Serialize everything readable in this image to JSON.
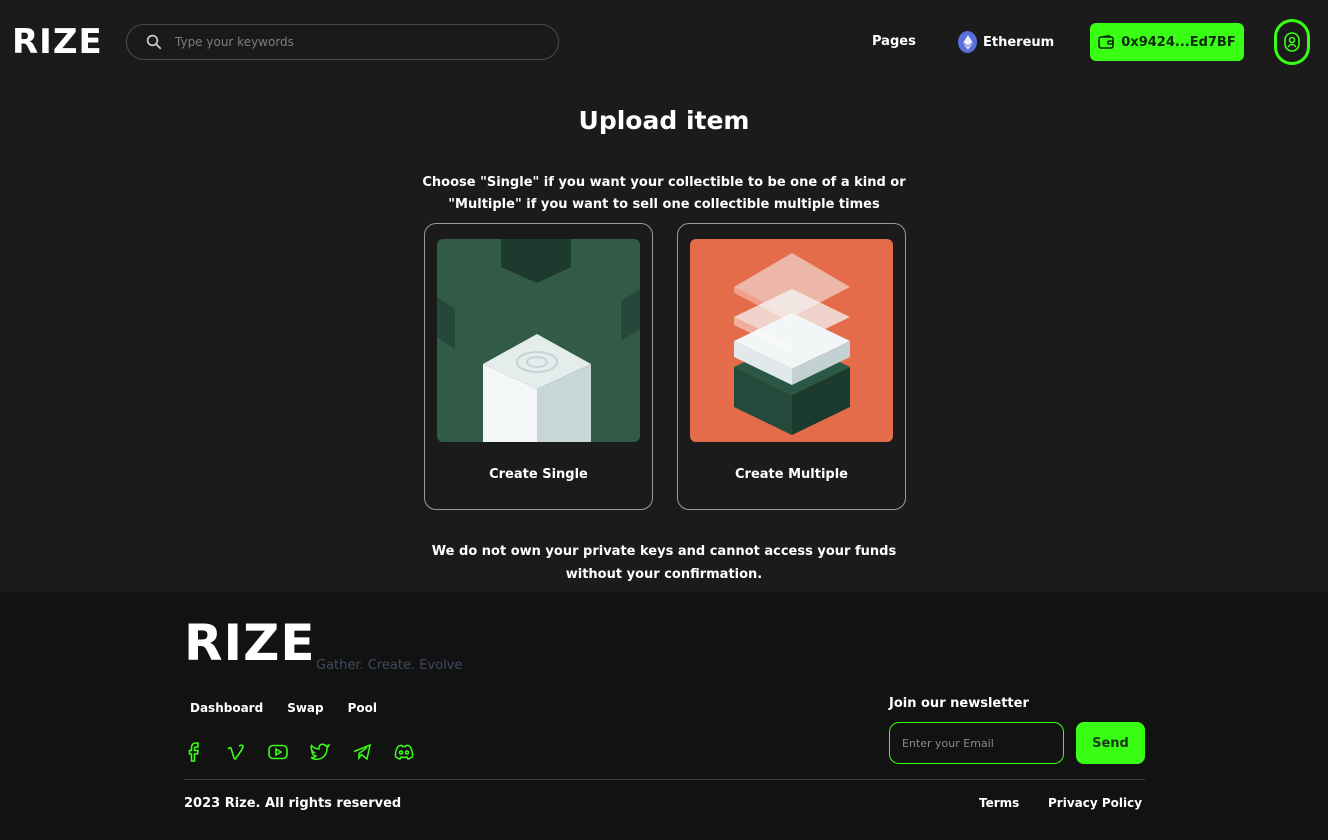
{
  "brand": {
    "logo_text": "RIZE",
    "accent_color": "#39ff14",
    "tagline": "Gather. Create. Evolve"
  },
  "header": {
    "search_placeholder": "Type your keywords",
    "nav_pages": "Pages",
    "network": "Ethereum",
    "wallet_address": "0x9424...Ed7BF"
  },
  "main": {
    "title": "Upload item",
    "intro_line1": "Choose \"Single\" if you want your collectible to be one of a kind or",
    "intro_line2": "\"Multiple\" if you want to sell one collectible multiple times",
    "cards": [
      {
        "label": "Create Single"
      },
      {
        "label": "Create Multiple"
      }
    ],
    "disclaimer_line1": "We do not own your private keys and cannot access your funds",
    "disclaimer_line2": "without your confirmation."
  },
  "footer": {
    "links": [
      "Dashboard",
      "Swap",
      "Pool"
    ],
    "social_icons": [
      "facebook-icon",
      "vimeo-icon",
      "youtube-icon",
      "twitter-icon",
      "telegram-icon",
      "discord-icon"
    ],
    "newsletter_title": "Join our newsletter",
    "email_placeholder": "Enter your Email",
    "send_label": "Send",
    "copyright": "2023 Rize. All rights reserved",
    "terms": "Terms",
    "privacy": "Privacy Policy"
  }
}
